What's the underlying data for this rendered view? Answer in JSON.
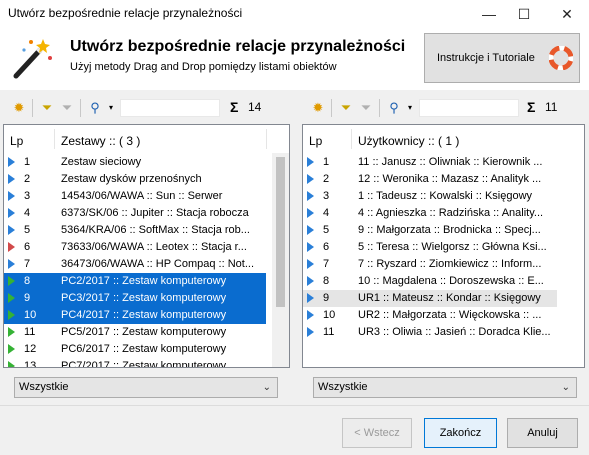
{
  "window": {
    "title": "Utwórz bezpośrednie relacje przynależności",
    "minimize": "—",
    "maximize": "☐",
    "close": "✕"
  },
  "header": {
    "title": "Utwórz bezpośrednie relacje przynależności",
    "subtitle": "Użyj metody Drag and Drop pomiędzy listami obiektów",
    "help_button": "Instrukcje i Tutoriale"
  },
  "left": {
    "count": "14",
    "col_lp": "Lp",
    "col_name": "Zestawy :: ( 3 )",
    "rows": [
      {
        "num": "1",
        "text": "Zestaw sieciowy",
        "arrow": "blue",
        "state": ""
      },
      {
        "num": "2",
        "text": "Zestaw dysków przenośnych",
        "arrow": "blue",
        "state": ""
      },
      {
        "num": "3",
        "text": "14543/06/WAWA :: Sun :: Serwer",
        "arrow": "blue",
        "state": ""
      },
      {
        "num": "4",
        "text": "6373/SK/06 :: Jupiter :: Stacja robocza",
        "arrow": "blue",
        "state": ""
      },
      {
        "num": "5",
        "text": "5364/KRA/06 :: SoftMax :: Stacja rob...",
        "arrow": "blue",
        "state": ""
      },
      {
        "num": "6",
        "text": "73633/06/WAWA :: Leotex :: Stacja r...",
        "arrow": "red",
        "state": ""
      },
      {
        "num": "7",
        "text": "36473/06/WAWA :: HP Compaq :: Not...",
        "arrow": "blue",
        "state": ""
      },
      {
        "num": "8",
        "text": "PC2/2017 :: Zestaw komputerowy",
        "arrow": "green",
        "state": "sel"
      },
      {
        "num": "9",
        "text": "PC3/2017 :: Zestaw komputerowy",
        "arrow": "green",
        "state": "sel"
      },
      {
        "num": "10",
        "text": "PC4/2017 :: Zestaw komputerowy",
        "arrow": "green",
        "state": "sel"
      },
      {
        "num": "11",
        "text": "PC5/2017 :: Zestaw komputerowy",
        "arrow": "green",
        "state": ""
      },
      {
        "num": "12",
        "text": "PC6/2017 :: Zestaw komputerowy",
        "arrow": "green",
        "state": ""
      },
      {
        "num": "13",
        "text": "PC7/2017 :: Zestaw komputerowy",
        "arrow": "green",
        "state": ""
      }
    ],
    "filter": "Wszystkie"
  },
  "right": {
    "count": "11",
    "col_lp": "Lp",
    "col_name": "Użytkownicy :: ( 1 )",
    "rows": [
      {
        "num": "1",
        "text": "11 :: Janusz :: Oliwniak :: Kierownik ...",
        "arrow": "blue",
        "state": ""
      },
      {
        "num": "2",
        "text": "12 :: Weronika :: Mazasz :: Analityk ...",
        "arrow": "blue",
        "state": ""
      },
      {
        "num": "3",
        "text": "1 :: Tadeusz :: Kowalski :: Księgowy",
        "arrow": "blue",
        "state": ""
      },
      {
        "num": "4",
        "text": "4 :: Agnieszka :: Radzińska :: Anality...",
        "arrow": "blue",
        "state": ""
      },
      {
        "num": "5",
        "text": "9 :: Małgorzata :: Brodnicka :: Specj...",
        "arrow": "blue",
        "state": ""
      },
      {
        "num": "6",
        "text": "5 :: Teresa :: Wielgorsz :: Główna Ksi...",
        "arrow": "blue",
        "state": ""
      },
      {
        "num": "7",
        "text": "7 :: Ryszard :: Ziomkiewicz :: Inform...",
        "arrow": "blue",
        "state": ""
      },
      {
        "num": "8",
        "text": "10 :: Magdalena :: Doroszewska :: E...",
        "arrow": "blue",
        "state": ""
      },
      {
        "num": "9",
        "text": "UR1 :: Mateusz :: Kondar :: Księgowy",
        "arrow": "blue",
        "state": "hl"
      },
      {
        "num": "10",
        "text": "UR2 :: Małgorzata :: Więckowska :: ...",
        "arrow": "blue",
        "state": ""
      },
      {
        "num": "11",
        "text": "UR3 :: Oliwia :: Jasień :: Doradca Klie...",
        "arrow": "blue",
        "state": ""
      }
    ],
    "filter": "Wszystkie"
  },
  "buttons": {
    "back": "< Wstecz",
    "finish": "Zakończ",
    "cancel": "Anuluj"
  },
  "colors": {
    "selection": "#0a6ccf",
    "arrow_blue": "#2a7fd8",
    "arrow_green": "#35b235",
    "arrow_red": "#d24a4a"
  }
}
